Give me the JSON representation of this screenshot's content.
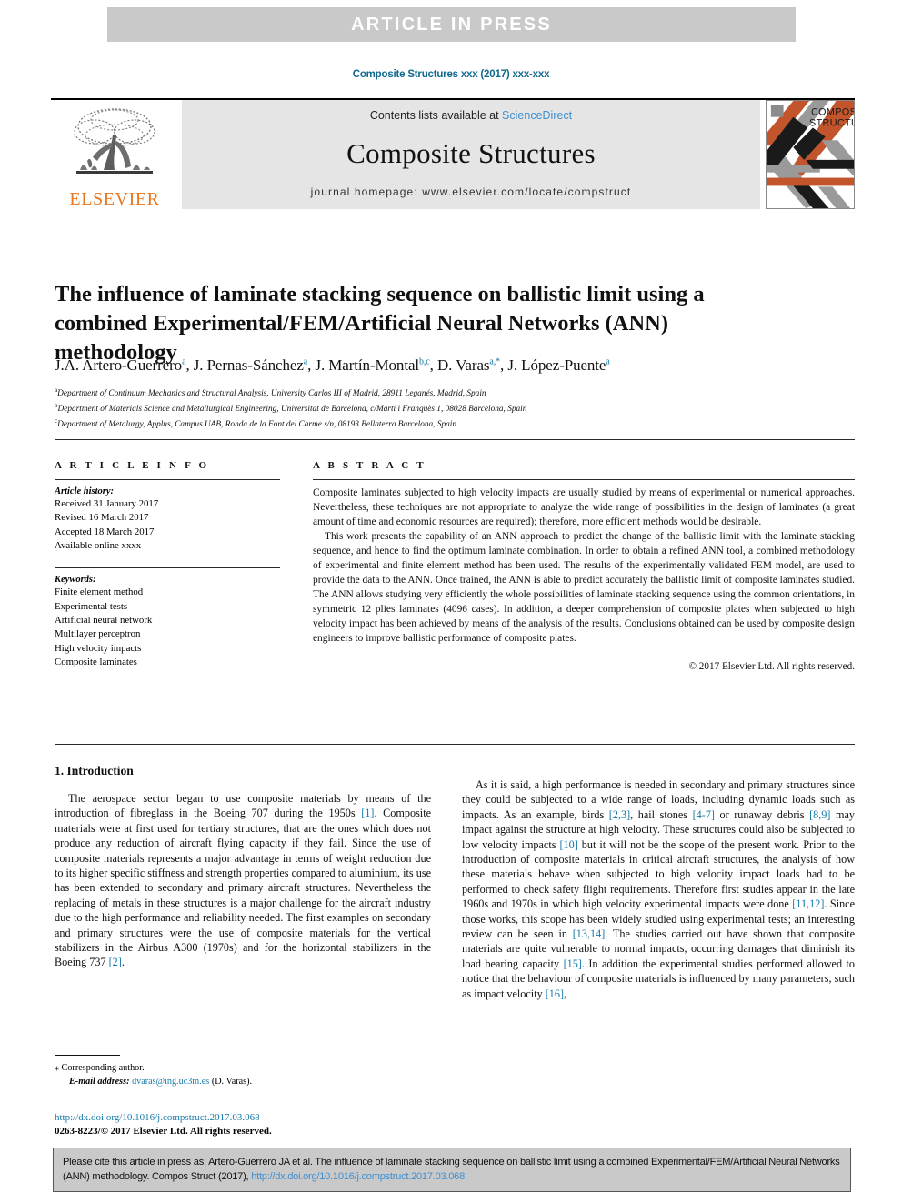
{
  "banner": {
    "text": "ARTICLE  IN  PRESS",
    "bg_color": "#c9c9c9",
    "text_color": "#ffffff"
  },
  "journal_ref": "Composite Structures xxx (2017) xxx-xxx",
  "masthead": {
    "publisher_wordmark": "ELSEVIER",
    "contents_prefix": "Contents lists available at ",
    "contents_link": "ScienceDirect",
    "journal_title": "Composite Structures",
    "homepage": "journal homepage: www.elsevier.com/locate/compstruct",
    "cover_title_line1": "COMPOSITE",
    "cover_title_line2": "STRUCTURES",
    "link_color": "#3f8fd0",
    "accent_orange": "#e87722"
  },
  "article": {
    "title": "The influence of laminate stacking sequence on ballistic limit using a combined Experimental/FEM/Artificial Neural Networks (ANN) methodology",
    "authors": [
      {
        "name": "J.A. Artero-Guerrero",
        "marks": "a"
      },
      {
        "name": "J. Pernas-Sánchez",
        "marks": "a"
      },
      {
        "name": "J. Martín-Montal",
        "marks": "b,c"
      },
      {
        "name": "D. Varas",
        "marks": "a,*"
      },
      {
        "name": "J. López-Puente",
        "marks": "a"
      }
    ],
    "affiliations": [
      {
        "mark": "a",
        "text": "Department of Continuum Mechanics and Structural Analysis, University Carlos III of Madrid, 28911 Leganés, Madrid, Spain"
      },
      {
        "mark": "b",
        "text": "Department of Materials Science and Metallurgical Engineering, Universitat de Barcelona, c/Martí i Franquès 1, 08028 Barcelona, Spain"
      },
      {
        "mark": "c",
        "text": "Department of Metalurgy, Applus, Campus UAB, Ronda de la Font del Carme s/n, 08193 Bellaterra Barcelona, Spain"
      }
    ]
  },
  "article_info": {
    "section_label": "A R T I C L E    I N F O",
    "history_heading": "Article history:",
    "history": [
      "Received 31 January 2017",
      "Revised 16 March 2017",
      "Accepted 18 March 2017",
      "Available online xxxx"
    ],
    "keywords_heading": "Keywords:",
    "keywords": [
      "Finite element method",
      "Experimental tests",
      "Artificial neural network",
      "Multilayer perceptron",
      "High velocity impacts",
      "Composite laminates"
    ]
  },
  "abstract": {
    "section_label": "A B S T R A C T",
    "paragraphs": [
      "Composite laminates subjected to high velocity impacts are usually studied by means of experimental or numerical approaches. Nevertheless, these techniques are not appropriate to analyze the wide range of possibilities in the design of laminates (a great amount of time and economic resources are required); therefore, more efficient methods would be desirable.",
      "This work presents the capability of an ANN approach to predict the change of the ballistic limit with the laminate stacking sequence, and hence to find the optimum laminate combination. In order to obtain a refined ANN tool, a combined methodology of experimental and finite element method has been used. The results of the experimentally validated FEM model, are used to provide the data to the ANN. Once trained, the ANN is able to predict accurately the ballistic limit of composite laminates studied. The ANN allows studying very efficiently the whole possibilities of laminate stacking sequence using the common orientations, in symmetric 12 plies laminates (4096 cases). In addition, a deeper comprehension of composite plates when subjected to high velocity impact has been achieved by means of the analysis of the results. Conclusions obtained can be used by composite design engineers to improve ballistic performance of composite plates."
    ],
    "copyright": "© 2017 Elsevier Ltd. All rights reserved."
  },
  "body": {
    "section_title": "1. Introduction",
    "left_paragraph": "The aerospace sector began to use composite materials by means of the introduction of fibreglass in the Boeing 707 during the 1950s [1]. Composite materials were at first used for tertiary structures, that are the ones which does not produce any reduction of aircraft flying capacity if they fail. Since the use of composite materials represents a major advantage in terms of weight reduction due to its higher specific stiffness and strength properties compared to aluminium, its use has been extended to secondary and primary aircraft structures. Nevertheless the replacing of metals in these structures is a major challenge for the aircraft industry due to the high performance and reliability needed. The first examples on secondary and primary structures were the use of composite materials for the vertical stabilizers in the Airbus A300 (1970s) and for the horizontal stabilizers in the Boeing 737 [2].",
    "right_paragraph": "As it is said, a high performance is needed in secondary and primary structures since they could be subjected to a wide range of loads, including dynamic loads such as impacts. As an example, birds [2,3], hail stones [4-7] or runaway debris [8,9] may impact against the structure at high velocity. These structures could also be subjected to low velocity impacts [10] but it will not be the scope of the present work. Prior to the introduction of composite materials in critical aircraft structures, the analysis of how these materials behave when subjected to high velocity impact loads had to be performed to check safety flight requirements. Therefore first studies appear in the late 1960s and 1970s in which high velocity experimental impacts were done [11,12]. Since those works, this scope has been widely studied using experimental tests; an interesting review can be seen in [13,14]. The studies carried out have shown that composite materials are quite vulnerable to normal impacts, occurring damages that diminish its load bearing capacity [15]. In addition the experimental studies performed allowed to notice that the behaviour of composite materials is influenced by many parameters, such as impact velocity [16],"
  },
  "footnote": {
    "corresponding": "Corresponding author.",
    "email_label": "E-mail address:",
    "email": "dvaras@ing.uc3m.es",
    "email_owner": "(D. Varas)."
  },
  "footer": {
    "doi_url": "http://dx.doi.org/10.1016/j.compstruct.2017.03.068",
    "issn_line": "0263-8223/© 2017 Elsevier Ltd. All rights reserved."
  },
  "cite_box": {
    "text_before_link": "Please cite this article in press as: Artero-Guerrero JA et al. The influence of laminate stacking sequence on ballistic limit using a combined Experimental/FEM/Artificial Neural Networks (ANN) methodology. Compos Struct (2017), ",
    "link": "http://dx.doi.org/10.1016/j.compstruct.2017.03.068",
    "bg_color": "#c9c9c9"
  }
}
